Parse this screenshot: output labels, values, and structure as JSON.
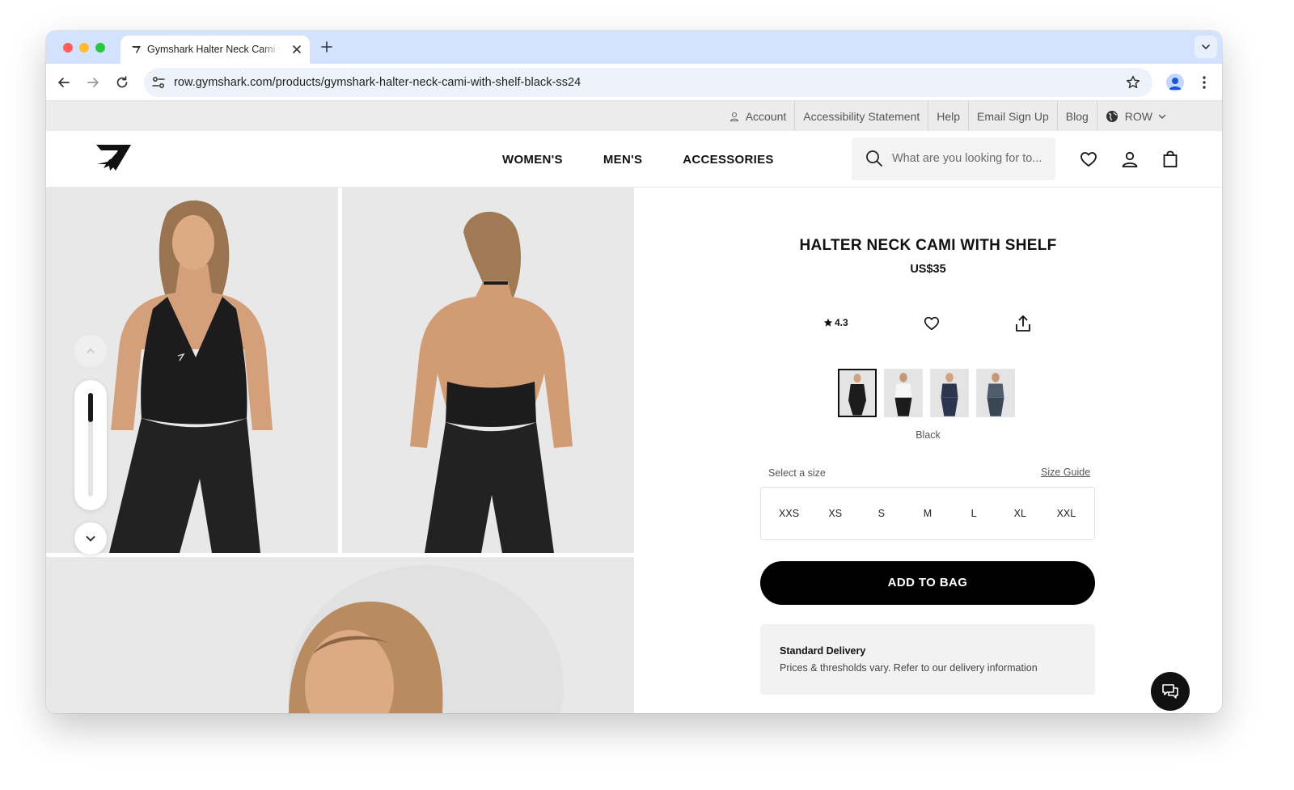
{
  "browser": {
    "tab_title": "Gymshark Halter Neck Cami with Shelf - Black",
    "url": "row.gymshark.com/products/gymshark-halter-neck-cami-with-shelf-black-ss24"
  },
  "utility_bar": {
    "account": "Account",
    "accessibility": "Accessibility Statement",
    "help": "Help",
    "email_signup": "Email Sign Up",
    "blog": "Blog",
    "region": "ROW"
  },
  "header": {
    "nav": [
      "WOMEN'S",
      "MEN'S",
      "ACCESSORIES"
    ],
    "search_placeholder": "What are you looking for to..."
  },
  "product": {
    "title": "HALTER NECK CAMI WITH SHELF",
    "price": "US$35",
    "rating": "4.3",
    "colour_selected": "Black",
    "swatch_count": 4,
    "size_label": "Select a size",
    "size_guide": "Size Guide",
    "sizes": [
      "XXS",
      "XS",
      "S",
      "M",
      "L",
      "XL",
      "XXL"
    ],
    "add_to_bag": "ADD TO BAG",
    "delivery_title": "Standard Delivery",
    "delivery_text": "Prices & thresholds vary. Refer to our delivery information"
  },
  "colors": {
    "tab_strip": "#d3e3fd",
    "utility_bar": "#ececec",
    "button": "#000000",
    "image_bg": "#e8e8e8"
  },
  "icons": {
    "favicon": "gymshark-logo-icon",
    "search": "search-icon",
    "wishlist": "heart-icon",
    "account": "user-icon",
    "bag": "bag-icon",
    "share": "share-icon",
    "chat": "chat-icon"
  }
}
